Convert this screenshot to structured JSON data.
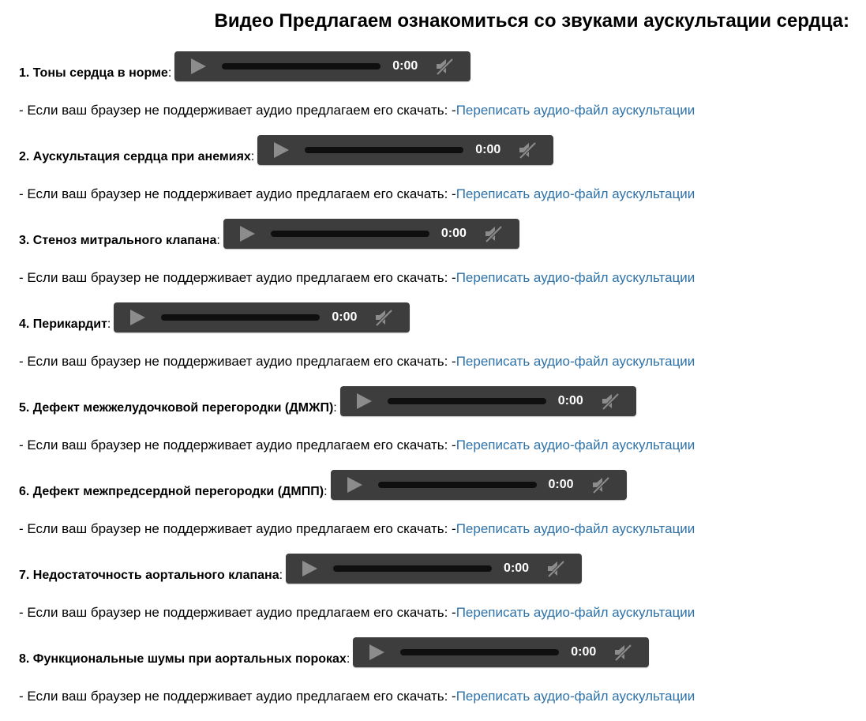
{
  "page": {
    "title": "Видео Предлагаем ознакомиться со звуками аускультации сердца:"
  },
  "common": {
    "download_text": "- Если ваш браузер не поддерживает аудио предлагаем его скачать: -",
    "download_link": "Переписать аудио-файл аускультации",
    "colon": ":",
    "time": "0:00"
  },
  "icons": {
    "play": "play-icon",
    "mute": "speaker-muted-icon"
  },
  "colors": {
    "player_bg": "#3d3d3d",
    "progress_track": "#0f0f0f",
    "link": "#2e72a8",
    "icon": "#8c8c8c"
  },
  "tracks": [
    {
      "label": "1. Тоны сердца в норме"
    },
    {
      "label": "2. Аускультация сердца при анемиях"
    },
    {
      "label": "3. Стеноз митрального клапана"
    },
    {
      "label": "4. Перикардит"
    },
    {
      "label": "5. Дефект межжелудочковой перегородки (ДМЖП)"
    },
    {
      "label": "6. Дефект межпредсердной перегородки (ДМПП)"
    },
    {
      "label": "7. Недостаточность аортального клапана"
    },
    {
      "label": "8. Функциональные шумы при аортальных пороках"
    }
  ]
}
